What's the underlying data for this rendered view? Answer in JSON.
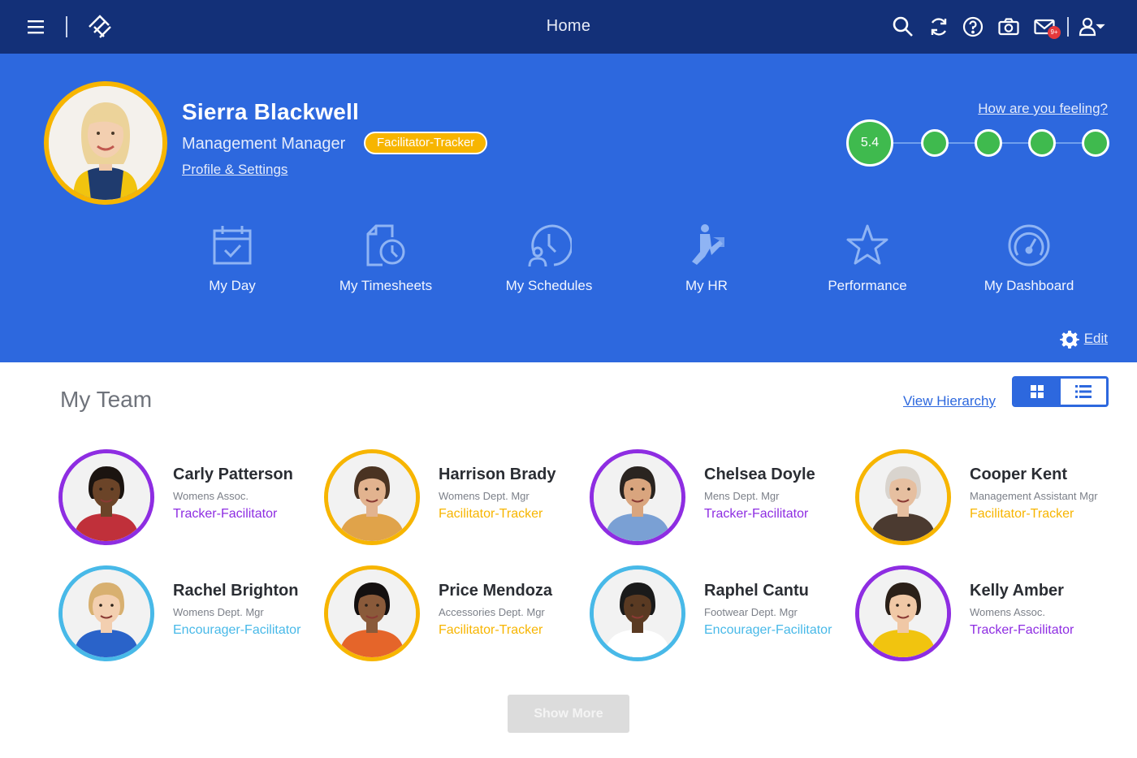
{
  "header": {
    "title": "Home",
    "notification_badge": "9+",
    "icons": [
      "menu-icon",
      "logo-icon",
      "search-icon",
      "refresh-icon",
      "help-icon",
      "camera-icon",
      "mail-icon",
      "user-menu-icon"
    ],
    "background": "#133078"
  },
  "profile": {
    "name": "Sierra Blackwell",
    "role": "Management Manager",
    "badge": "Facilitator-Tracker",
    "settings_link": "Profile & Settings",
    "feeling_link": "How are you feeling?",
    "mood_score": "5.4",
    "accent": "#2d68de",
    "badge_color": "#f7b500",
    "mood_color": "#3fba4e"
  },
  "tiles": [
    {
      "label": "My Day",
      "icon": "calendar-check-icon"
    },
    {
      "label": "My Timesheets",
      "icon": "timesheet-clock-icon"
    },
    {
      "label": "My Schedules",
      "icon": "schedule-person-clock-icon"
    },
    {
      "label": "My HR",
      "icon": "hr-person-icon"
    },
    {
      "label": "Performance",
      "icon": "star-icon"
    },
    {
      "label": "My Dashboard",
      "icon": "gauge-icon"
    }
  ],
  "edit_label": "Edit",
  "team": {
    "title": "My Team",
    "hierarchy_link": "View Hierarchy",
    "show_more": "Show More",
    "members": [
      {
        "name": "Carly Patterson",
        "dept": "Womens Assoc.",
        "role": "Tracker-Facilitator",
        "color": "#8e2de2"
      },
      {
        "name": "Harrison Brady",
        "dept": "Womens Dept. Mgr",
        "role": "Facilitator-Tracker",
        "color": "#f7b500"
      },
      {
        "name": "Chelsea Doyle",
        "dept": "Mens Dept. Mgr",
        "role": "Tracker-Facilitator",
        "color": "#8e2de2"
      },
      {
        "name": "Cooper Kent",
        "dept": "Management Assistant Mgr",
        "role": "Facilitator-Tracker",
        "color": "#f7b500"
      },
      {
        "name": "Rachel Brighton",
        "dept": "Womens Dept. Mgr",
        "role": "Encourager-Facilitator",
        "color": "#48b9e8"
      },
      {
        "name": "Price Mendoza",
        "dept": "Accessories Dept. Mgr",
        "role": "Facilitator-Tracker",
        "color": "#f7b500"
      },
      {
        "name": "Raphel Cantu",
        "dept": "Footwear Dept. Mgr",
        "role": "Encourager-Facilitator",
        "color": "#48b9e8"
      },
      {
        "name": "Kelly Amber",
        "dept": "Womens Assoc.",
        "role": "Tracker-Facilitator",
        "color": "#8e2de2"
      }
    ]
  }
}
